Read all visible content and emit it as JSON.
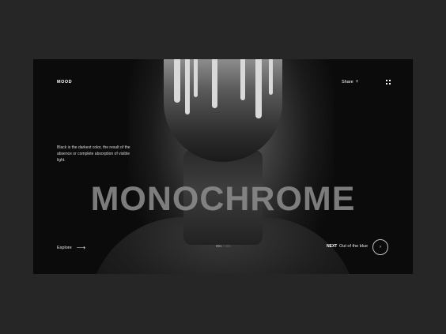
{
  "header": {
    "brand": "MOOD",
    "share_label": "Share",
    "share_icon": "plus-icon",
    "menu_icon": "grid-dots-icon"
  },
  "hero": {
    "description": "Black is the darkest color, the result of the absence or complete absorption of visible light.",
    "title": "MONOCHROME"
  },
  "footer": {
    "explore_label": "Explore",
    "explore_icon": "arrow-right-icon",
    "pager_current": "001",
    "pager_total": "/ 005",
    "next_label": "NEXT",
    "next_title": "Out of the blue",
    "next_icon": "chevron-right-icon"
  },
  "colors": {
    "page_background": "#262626",
    "card_background": "#0b0b0b",
    "title_color": "#8f8f8f",
    "text_color": "#ffffff"
  }
}
